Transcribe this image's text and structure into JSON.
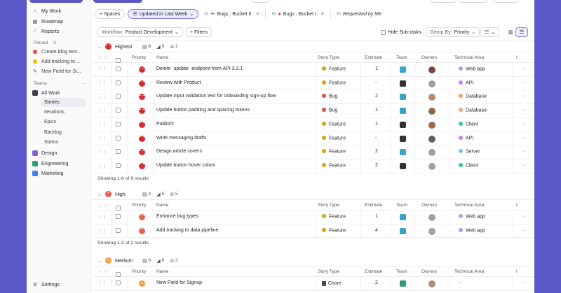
{
  "sidebar": {
    "nav": [
      {
        "label": "My Work",
        "icon": "home-icon"
      },
      {
        "label": "Roadmap",
        "icon": "map-icon"
      },
      {
        "label": "Reports",
        "icon": "chart-icon"
      }
    ],
    "pinned_label": "Pinned",
    "pinned_count": "3",
    "pinned": [
      {
        "label": "Create blog tem...",
        "icon": "bug-icon",
        "color": "#e5484d"
      },
      {
        "label": "Add tracking to ...",
        "icon": "feature-icon",
        "color": "#f5b400"
      },
      {
        "label": "New Field for Si...",
        "icon": "chore-icon",
        "color": "#555"
      }
    ],
    "teams_label": "Teams",
    "teams_more": "···",
    "all_work": "All Work",
    "sub": [
      "Stories",
      "Iterations",
      "Epics",
      "Backlog",
      "Status"
    ],
    "teams": [
      {
        "label": "Design",
        "color": "#8a63d2"
      },
      {
        "label": "Engineering",
        "color": "#2f9e77"
      },
      {
        "label": "Marketing",
        "color": "#3b82f6"
      }
    ],
    "settings": "Settings"
  },
  "filters": {
    "spaces": "+ Spaces",
    "active": "Updated in Last Week",
    "tabs": [
      "Bugs : Bucket II",
      "Bugs : Bucket I",
      "Requested by Me"
    ]
  },
  "toolbar": {
    "workflow_prefix": "Workflow:",
    "workflow": "Product Development",
    "filters": "+ Filters",
    "hide_subtasks": "Hide Sub-tasks",
    "group_by_prefix": "Group By:",
    "group_by": "Priority"
  },
  "columns": {
    "priority": "Priority",
    "name": "Name",
    "story_type": "Story Type",
    "estimate": "Estimate",
    "team": "Team",
    "owners": "Owners",
    "technical_area": "Technical Area",
    "more": "I"
  },
  "groups": [
    {
      "name": "Highest",
      "color": "#d62d2d",
      "glyph": "⌃⌃",
      "counts": [
        "8",
        "9",
        "1"
      ],
      "footer": "Showing 1-8 of 8 results",
      "rows": [
        {
          "name": "Delete `update` endpoint from API 3.2.1",
          "type": "Feature",
          "type_color": "#d4a514",
          "estimate": "1",
          "team_color": "#3aa3c9",
          "owner_color": "#7a4a3a",
          "area": "Web app",
          "area_color": "#b59ce0"
        },
        {
          "name": "Review with Product",
          "type": "Feature",
          "type_color": "#d4a514",
          "estimate": "-",
          "team_color": "#333",
          "owner_color": "#9aa0a8",
          "area": "API",
          "area_color": "#c084fc"
        },
        {
          "name": "Update input validation text for onboarding sign-up flow",
          "type": "Bug",
          "type_color": "#e5484d",
          "estimate": "2",
          "team_color": "#3aa3c9",
          "owner_color": "#b08a7a",
          "area": "Database",
          "area_color": "#f59e7a"
        },
        {
          "name": "Update button padding and spacing tokens",
          "type": "Bug",
          "type_color": "#e5484d",
          "estimate": "1",
          "team_color": "#3aa3c9",
          "owner_color": "#8a6a4a",
          "area": "Database",
          "area_color": "#f59e7a"
        },
        {
          "name": "Publish!",
          "type": "Feature",
          "type_color": "#d4a514",
          "estimate": "1",
          "team_color": "#333",
          "owner_color": "#9a6a4a",
          "area": "Client",
          "area_color": "#34c7a5"
        },
        {
          "name": "Write messaging drafts",
          "type": "Feature",
          "type_color": "#d4a514",
          "estimate": "-",
          "team_color": "#333",
          "owner_color": "#6a5a5a",
          "area": "API",
          "area_color": "#c084fc"
        },
        {
          "name": "Design article covers",
          "type": "Feature",
          "type_color": "#d4a514",
          "estimate": "2",
          "team_color": "#3aa3c9",
          "owner_color": "#9aa0a8",
          "area": "Server",
          "area_color": "#7fb8e8"
        },
        {
          "name": "Update button hover colors",
          "type": "Feature",
          "type_color": "#d4a514",
          "estimate": "2",
          "team_color": "#333",
          "owner_color": "#9aa0a8",
          "area": "Client",
          "area_color": "#34c7a5"
        }
      ]
    },
    {
      "name": "High",
      "color": "#e5634d",
      "glyph": "⌃",
      "counts": [
        "2",
        "5",
        "5"
      ],
      "footer": "Showing 1-2 of 2 results",
      "rows": [
        {
          "name": "Enhance bug types",
          "type": "Feature",
          "type_color": "#d4a514",
          "estimate": "1",
          "team_color": "#3aa3c9",
          "owner_color": "#9aa0a8",
          "area": "Web app",
          "area_color": "#b59ce0"
        },
        {
          "name": "Add tracking to data pipeline",
          "type": "Feature",
          "type_color": "#d4a514",
          "estimate": "4",
          "team_color": "#3aa3c9",
          "owner_color": "#9aa0a8",
          "area": "Web app",
          "area_color": "#b59ce0"
        }
      ]
    },
    {
      "name": "Medium",
      "color": "#f59e3b",
      "glyph": "=",
      "counts": [
        "6",
        "8",
        "2"
      ],
      "footer": "",
      "rows": [
        {
          "name": "New Field for Signup",
          "type": "Chore",
          "type_color": "#555",
          "estimate": "2",
          "team_color": "#2f9e77",
          "owner_color": "#b08a7a",
          "area": "-",
          "area_color": ""
        }
      ]
    }
  ]
}
